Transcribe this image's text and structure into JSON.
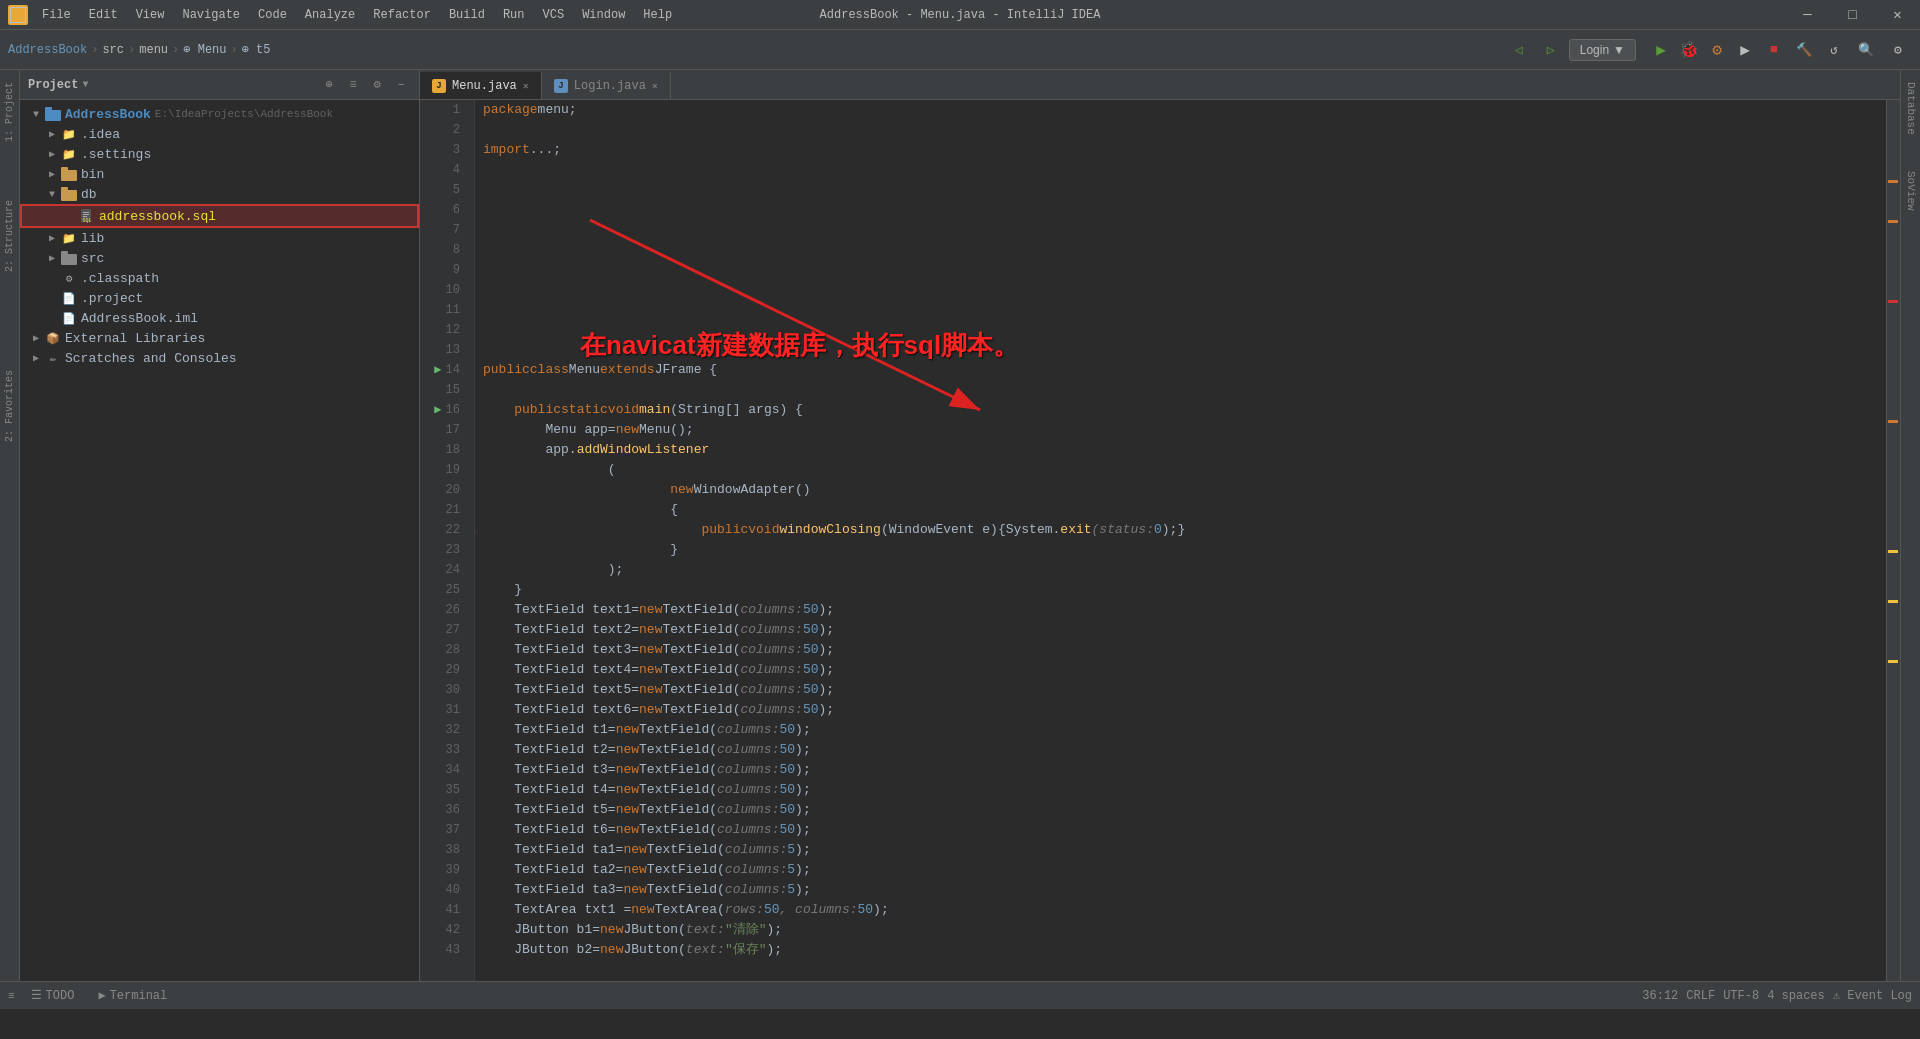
{
  "titleBar": {
    "title": "AddressBook - Menu.java - IntelliJ IDEA",
    "menuItems": [
      "File",
      "Edit",
      "View",
      "Navigate",
      "Code",
      "Analyze",
      "Refactor",
      "Build",
      "Run",
      "VCS",
      "Window",
      "Help"
    ]
  },
  "breadcrumb": {
    "items": [
      "AddressBook",
      "src",
      "menu",
      "Menu",
      "t5"
    ]
  },
  "projectPanel": {
    "title": "Project",
    "tree": [
      {
        "id": "addressbook-root",
        "label": "AddressBook",
        "suffix": "E:\\IdeaProjects\\AddressBook",
        "level": 0,
        "type": "root",
        "open": true
      },
      {
        "id": "idea",
        "label": ".idea",
        "level": 1,
        "type": "folder",
        "open": false
      },
      {
        "id": "settings",
        "label": ".settings",
        "level": 1,
        "type": "folder",
        "open": false
      },
      {
        "id": "bin",
        "label": "bin",
        "level": 1,
        "type": "folder-brown",
        "open": false
      },
      {
        "id": "db",
        "label": "db",
        "level": 1,
        "type": "folder-brown",
        "open": true
      },
      {
        "id": "addressbook-sql",
        "label": "addressbook.sql",
        "level": 2,
        "type": "sql",
        "highlighted": true
      },
      {
        "id": "lib",
        "label": "lib",
        "level": 1,
        "type": "folder",
        "open": false
      },
      {
        "id": "src",
        "label": "src",
        "level": 1,
        "type": "src",
        "open": false
      },
      {
        "id": "classpath",
        "label": ".classpath",
        "level": 1,
        "type": "classpath"
      },
      {
        "id": "project",
        "label": ".project",
        "level": 1,
        "type": "project"
      },
      {
        "id": "iml",
        "label": "AddressBook.iml",
        "level": 1,
        "type": "iml"
      },
      {
        "id": "ext-libs",
        "label": "External Libraries",
        "level": 0,
        "type": "ext-libs"
      },
      {
        "id": "scratches",
        "label": "Scratches and Consoles",
        "level": 0,
        "type": "scratches"
      }
    ]
  },
  "editorTabs": [
    {
      "id": "menu-java",
      "label": "Menu.java",
      "active": true,
      "modified": false
    },
    {
      "id": "login-java",
      "label": "Login.java",
      "active": false,
      "modified": false
    }
  ],
  "codeLines": [
    {
      "num": 1,
      "content": "package menu;",
      "tokens": [
        {
          "t": "kw",
          "v": "package"
        },
        {
          "t": "pkg",
          "v": " menu;"
        }
      ]
    },
    {
      "num": 2,
      "content": "",
      "tokens": []
    },
    {
      "num": 3,
      "content": "import ...;",
      "tokens": [
        {
          "t": "kw",
          "v": "import"
        },
        {
          "t": "pkg",
          "v": " ..."
        }
      ]
    },
    {
      "num": 14,
      "content": "public class Menu extends JFrame {",
      "tokens": [
        {
          "t": "kw",
          "v": "public"
        },
        {
          "t": "var",
          "v": " "
        },
        {
          "t": "kw",
          "v": "class"
        },
        {
          "t": "var",
          "v": " Menu "
        },
        {
          "t": "kw",
          "v": "extends"
        },
        {
          "t": "var",
          "v": " JFrame {"
        }
      ]
    },
    {
      "num": 15,
      "content": "",
      "tokens": []
    },
    {
      "num": 16,
      "content": "    public static void main(String[] args) {",
      "tokens": [
        {
          "t": "kw",
          "v": "    public"
        },
        {
          "t": "var",
          "v": " "
        },
        {
          "t": "kw",
          "v": "static"
        },
        {
          "t": "var",
          "v": " "
        },
        {
          "t": "kw",
          "v": "void"
        },
        {
          "t": "var",
          "v": " "
        },
        {
          "t": "fn",
          "v": "main"
        },
        {
          "t": "var",
          "v": "(String[] args) {"
        }
      ]
    },
    {
      "num": 17,
      "content": "        Menu app=new Menu();",
      "tokens": [
        {
          "t": "var",
          "v": "        Menu app="
        },
        {
          "t": "kw",
          "v": "new"
        },
        {
          "t": "var",
          "v": " Menu();"
        }
      ]
    },
    {
      "num": 18,
      "content": "        app.addWindowListener",
      "tokens": [
        {
          "t": "var",
          "v": "        app."
        },
        {
          "t": "fn",
          "v": "addWindowListener"
        }
      ]
    },
    {
      "num": 19,
      "content": "                (",
      "tokens": [
        {
          "t": "var",
          "v": "                ("
        }
      ]
    },
    {
      "num": 20,
      "content": "                        new WindowAdapter()",
      "tokens": [
        {
          "t": "var",
          "v": "                        "
        },
        {
          "t": "kw",
          "v": "new"
        },
        {
          "t": "var",
          "v": " WindowAdapter()"
        }
      ]
    },
    {
      "num": 21,
      "content": "                        {",
      "tokens": [
        {
          "t": "var",
          "v": "                        {"
        }
      ]
    },
    {
      "num": 22,
      "content": "                            public void windowClosing(WindowEvent e){System.exit(status: 0);}",
      "tokens": [
        {
          "t": "kw",
          "v": "                            public"
        },
        {
          "t": "var",
          "v": " "
        },
        {
          "t": "kw",
          "v": "void"
        },
        {
          "t": "var",
          "v": " "
        },
        {
          "t": "fn",
          "v": "windowClosing"
        },
        {
          "t": "var",
          "v": "(WindowEvent e){System."
        },
        {
          "t": "fn",
          "v": "exit"
        },
        {
          "t": "hint",
          "v": "(status: "
        },
        {
          "t": "num",
          "v": "0"
        },
        {
          "t": "var",
          "v": ");}"
        }
      ]
    },
    {
      "num": 23,
      "content": "                        }",
      "tokens": [
        {
          "t": "var",
          "v": "                        }"
        }
      ]
    },
    {
      "num": 24,
      "content": "                );",
      "tokens": [
        {
          "t": "var",
          "v": "                );"
        }
      ]
    },
    {
      "num": 25,
      "content": "    }",
      "tokens": [
        {
          "t": "var",
          "v": "    }"
        }
      ]
    },
    {
      "num": 26,
      "content": "    TextField text1=new TextField( columns: 50);",
      "tokens": [
        {
          "t": "var",
          "v": "    TextField text1="
        },
        {
          "t": "kw",
          "v": "new"
        },
        {
          "t": "var",
          "v": " TextField("
        },
        {
          "t": "hint",
          "v": " columns: "
        },
        {
          "t": "num",
          "v": "50"
        },
        {
          "t": "var",
          "v": ");"
        }
      ]
    },
    {
      "num": 27,
      "content": "    TextField text2=new TextField( columns: 50);",
      "tokens": [
        {
          "t": "var",
          "v": "    TextField text2="
        },
        {
          "t": "kw",
          "v": "new"
        },
        {
          "t": "var",
          "v": " TextField("
        },
        {
          "t": "hint",
          "v": " columns: "
        },
        {
          "t": "num",
          "v": "50"
        },
        {
          "t": "var",
          "v": ");"
        }
      ]
    },
    {
      "num": 28,
      "content": "    TextField text3=new TextField( columns: 50);",
      "tokens": [
        {
          "t": "var",
          "v": "    TextField text3="
        },
        {
          "t": "kw",
          "v": "new"
        },
        {
          "t": "var",
          "v": " TextField("
        },
        {
          "t": "hint",
          "v": " columns: "
        },
        {
          "t": "num",
          "v": "50"
        },
        {
          "t": "var",
          "v": ");"
        }
      ]
    },
    {
      "num": 29,
      "content": "    TextField text4=new TextField( columns: 50);",
      "tokens": [
        {
          "t": "var",
          "v": "    TextField text4="
        },
        {
          "t": "kw",
          "v": "new"
        },
        {
          "t": "var",
          "v": " TextField("
        },
        {
          "t": "hint",
          "v": " columns: "
        },
        {
          "t": "num",
          "v": "50"
        },
        {
          "t": "var",
          "v": ");"
        }
      ]
    },
    {
      "num": 30,
      "content": "    TextField text5=new TextField( columns: 50);",
      "tokens": [
        {
          "t": "var",
          "v": "    TextField text5="
        },
        {
          "t": "kw",
          "v": "new"
        },
        {
          "t": "var",
          "v": " TextField("
        },
        {
          "t": "hint",
          "v": " columns: "
        },
        {
          "t": "num",
          "v": "50"
        },
        {
          "t": "var",
          "v": ");"
        }
      ]
    },
    {
      "num": 31,
      "content": "    TextField text6=new TextField( columns: 50);",
      "tokens": [
        {
          "t": "var",
          "v": "    TextField text6="
        },
        {
          "t": "kw",
          "v": "new"
        },
        {
          "t": "var",
          "v": " TextField("
        },
        {
          "t": "hint",
          "v": " columns: "
        },
        {
          "t": "num",
          "v": "50"
        },
        {
          "t": "var",
          "v": ");"
        }
      ]
    },
    {
      "num": 32,
      "content": "    TextField t1=new TextField( columns: 50);",
      "tokens": [
        {
          "t": "var",
          "v": "    TextField t1="
        },
        {
          "t": "kw",
          "v": "new"
        },
        {
          "t": "var",
          "v": " TextField("
        },
        {
          "t": "hint",
          "v": " columns: "
        },
        {
          "t": "num",
          "v": "50"
        },
        {
          "t": "var",
          "v": ");"
        }
      ]
    },
    {
      "num": 33,
      "content": "    TextField t2=new TextField( columns: 50);",
      "tokens": [
        {
          "t": "var",
          "v": "    TextField t2="
        },
        {
          "t": "kw",
          "v": "new"
        },
        {
          "t": "var",
          "v": " TextField("
        },
        {
          "t": "hint",
          "v": " columns: "
        },
        {
          "t": "num",
          "v": "50"
        },
        {
          "t": "var",
          "v": ");"
        }
      ]
    },
    {
      "num": 34,
      "content": "    TextField t3=new TextField( columns: 50);",
      "tokens": [
        {
          "t": "var",
          "v": "    TextField t3="
        },
        {
          "t": "kw",
          "v": "new"
        },
        {
          "t": "var",
          "v": " TextField("
        },
        {
          "t": "hint",
          "v": " columns: "
        },
        {
          "t": "num",
          "v": "50"
        },
        {
          "t": "var",
          "v": ");"
        }
      ]
    },
    {
      "num": 35,
      "content": "    TextField t4=new TextField( columns: 50);",
      "tokens": [
        {
          "t": "var",
          "v": "    TextField t4="
        },
        {
          "t": "kw",
          "v": "new"
        },
        {
          "t": "var",
          "v": " TextField("
        },
        {
          "t": "hint",
          "v": " columns: "
        },
        {
          "t": "num",
          "v": "50"
        },
        {
          "t": "var",
          "v": ");"
        }
      ]
    },
    {
      "num": 36,
      "content": "    TextField t5=new TextField( columns: 50);",
      "tokens": [
        {
          "t": "var",
          "v": "    TextField t5="
        },
        {
          "t": "kw",
          "v": "new"
        },
        {
          "t": "var",
          "v": " TextField("
        },
        {
          "t": "hint",
          "v": " columns: "
        },
        {
          "t": "num",
          "v": "50"
        },
        {
          "t": "var",
          "v": ");"
        }
      ],
      "bulb": true
    },
    {
      "num": 37,
      "content": "    TextField t6=new TextField( columns: 50);",
      "tokens": [
        {
          "t": "var",
          "v": "    TextField t6="
        },
        {
          "t": "kw",
          "v": "new"
        },
        {
          "t": "var",
          "v": " TextField("
        },
        {
          "t": "hint",
          "v": " columns: "
        },
        {
          "t": "num",
          "v": "50"
        },
        {
          "t": "var",
          "v": ");"
        }
      ]
    },
    {
      "num": 38,
      "content": "    TextField ta1=new TextField( columns: 5);",
      "tokens": [
        {
          "t": "var",
          "v": "    TextField ta1="
        },
        {
          "t": "kw",
          "v": "new"
        },
        {
          "t": "var",
          "v": " TextField("
        },
        {
          "t": "hint",
          "v": " columns: "
        },
        {
          "t": "num",
          "v": "5"
        },
        {
          "t": "var",
          "v": ");"
        }
      ]
    },
    {
      "num": 39,
      "content": "    TextField ta2=new TextField( columns: 5);",
      "tokens": [
        {
          "t": "var",
          "v": "    TextField ta2="
        },
        {
          "t": "kw",
          "v": "new"
        },
        {
          "t": "var",
          "v": " TextField("
        },
        {
          "t": "hint",
          "v": " columns: "
        },
        {
          "t": "num",
          "v": "5"
        },
        {
          "t": "var",
          "v": ");"
        }
      ]
    },
    {
      "num": 40,
      "content": "    TextField ta3=new TextField( columns: 5);",
      "tokens": [
        {
          "t": "var",
          "v": "    TextField ta3="
        },
        {
          "t": "kw",
          "v": "new"
        },
        {
          "t": "var",
          "v": " TextField("
        },
        {
          "t": "hint",
          "v": " columns: "
        },
        {
          "t": "num",
          "v": "5"
        },
        {
          "t": "var",
          "v": ");"
        }
      ]
    },
    {
      "num": 41,
      "content": "    TextArea txt1 =new TextArea( rows: 50, columns: 50);",
      "tokens": [
        {
          "t": "var",
          "v": "    TextArea txt1 ="
        },
        {
          "t": "kw",
          "v": "new"
        },
        {
          "t": "var",
          "v": " TextArea("
        },
        {
          "t": "hint",
          "v": " rows: "
        },
        {
          "t": "num",
          "v": "50"
        },
        {
          "t": "hint",
          "v": ", columns: "
        },
        {
          "t": "num",
          "v": "50"
        },
        {
          "t": "var",
          "v": ");"
        }
      ]
    },
    {
      "num": 42,
      "content": "    JButton b1=new JButton( text: \"清除\");",
      "tokens": [
        {
          "t": "var",
          "v": "    JButton b1="
        },
        {
          "t": "kw",
          "v": "new"
        },
        {
          "t": "var",
          "v": " JButton("
        },
        {
          "t": "hint",
          "v": " text: "
        },
        {
          "t": "str",
          "v": "\"清除\""
        },
        {
          "t": "var",
          "v": ");"
        }
      ]
    },
    {
      "num": 43,
      "content": "    JButton b2=new JButton( text: \"保存\");",
      "tokens": [
        {
          "t": "var",
          "v": "    JButton b2="
        },
        {
          "t": "kw",
          "v": "new"
        },
        {
          "t": "var",
          "v": " JButton("
        },
        {
          "t": "hint",
          "v": " text: "
        },
        {
          "t": "str",
          "v": "\"保存\""
        },
        {
          "t": "var",
          "v": ");"
        }
      ]
    }
  ],
  "annotation": {
    "text": "在navicat新建数据库，执行sql脚本。",
    "color": "#ff2222"
  },
  "statusBar": {
    "row": 36,
    "col": 12,
    "lineEnding": "CRLF",
    "encoding": "UTF-8",
    "indent": "4 spaces",
    "eventLog": "Event Log"
  },
  "bottomTabs": [
    {
      "label": "TODO",
      "icon": "☰"
    },
    {
      "label": "Terminal",
      "icon": "▶"
    }
  ],
  "rightSidebarTabs": [
    "Database",
    "SoView"
  ],
  "loginBtn": "Login"
}
